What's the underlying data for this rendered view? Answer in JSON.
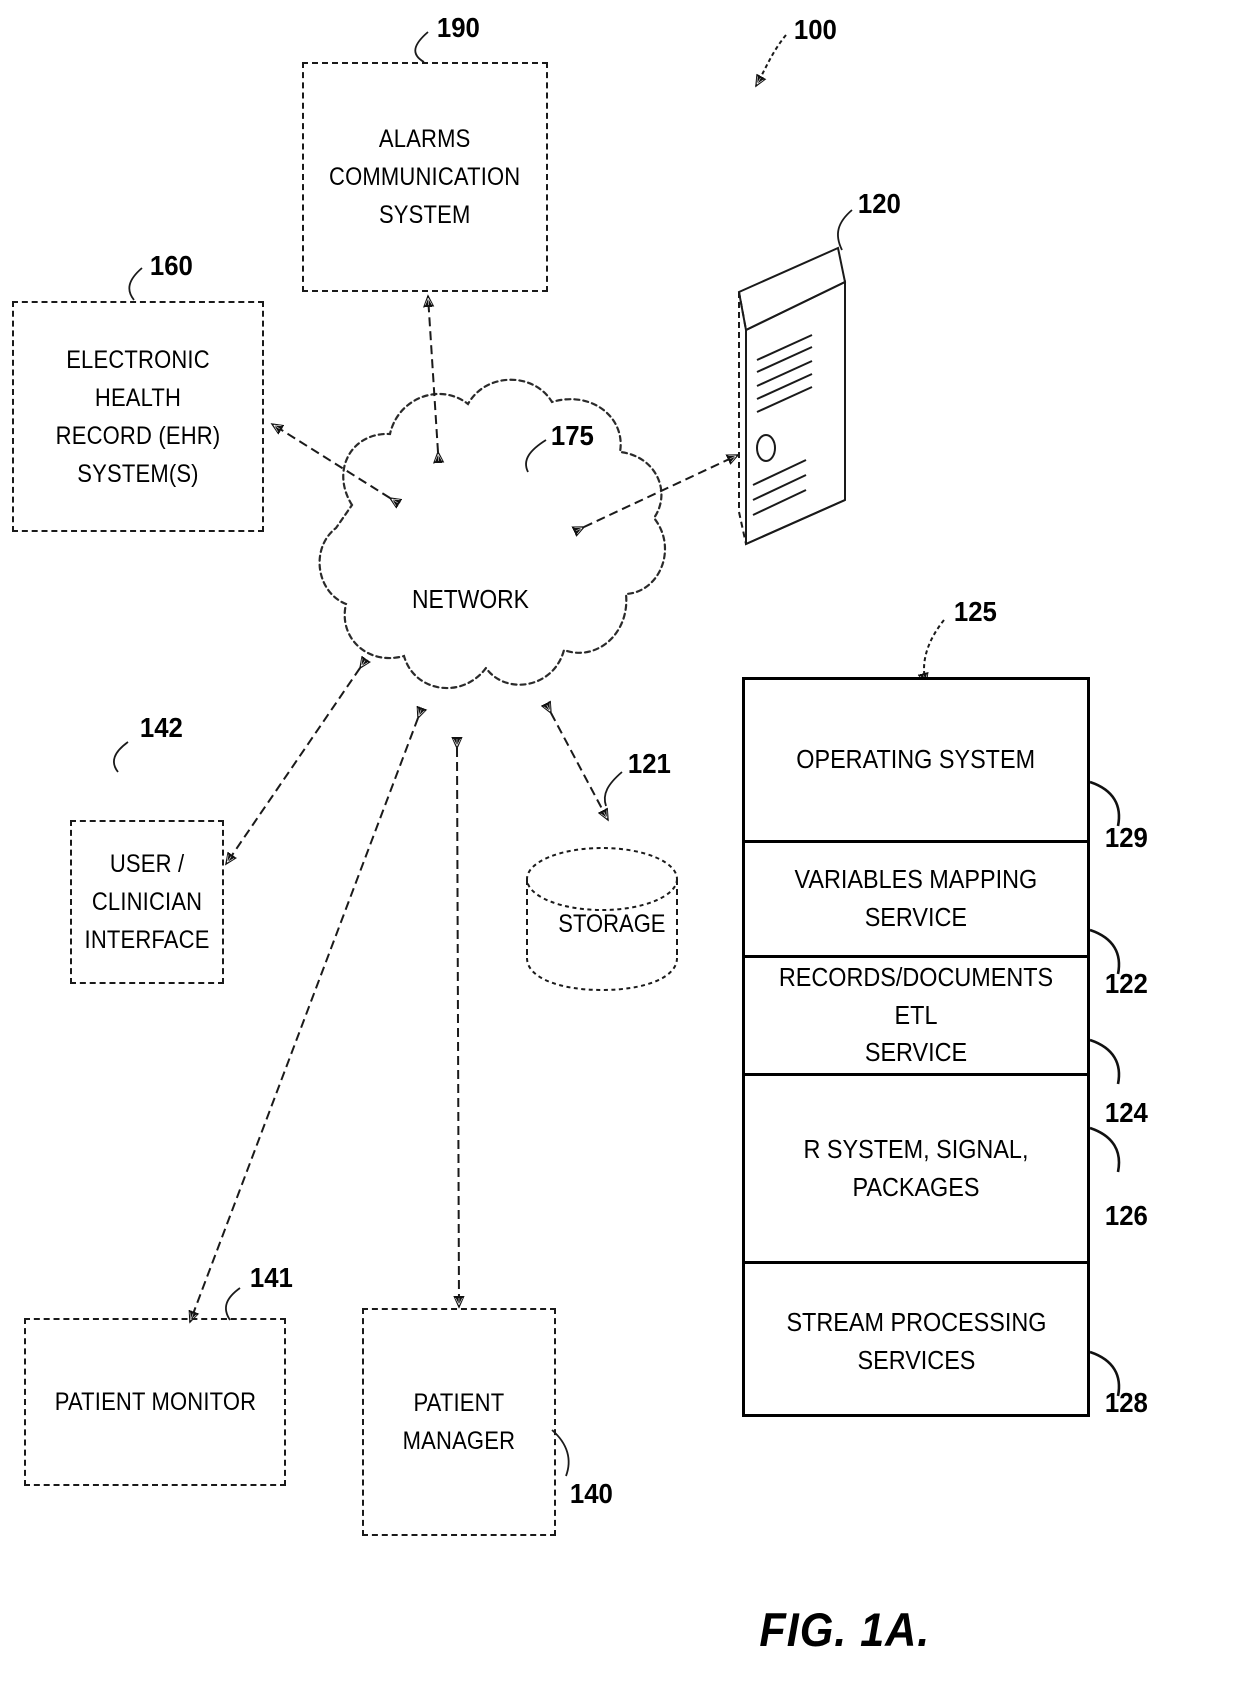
{
  "figure": {
    "caption": "FIG. 1A.",
    "system_ref": "100"
  },
  "nodes": [
    {
      "id": "alarms",
      "name": "alarms-communication-system",
      "label": "ALARMS\nCOMMUNICATION\nSYSTEM",
      "ref": "190"
    },
    {
      "id": "ehr",
      "name": "ehr-system",
      "label": "ELECTRONIC HEALTH\nRECORD (EHR)\nSYSTEM(S)",
      "ref": "160"
    },
    {
      "id": "user-interface",
      "name": "user-clinician-interface",
      "label": "USER /\nCLINICIAN\nINTERFACE",
      "ref": "142"
    },
    {
      "id": "patient-monitor",
      "name": "patient-monitor",
      "label": "PATIENT MONITOR",
      "ref": "141"
    },
    {
      "id": "patient-manager",
      "name": "patient-manager",
      "label": "PATIENT\nMANAGER",
      "ref": "140"
    }
  ],
  "network": {
    "label": "NETWORK",
    "ref": "175"
  },
  "storage": {
    "label": "STORAGE",
    "ref": "121"
  },
  "server": {
    "ref": "120"
  },
  "stack": {
    "ref": "125",
    "rows": [
      {
        "label": "OPERATING SYSTEM",
        "ref": "129"
      },
      {
        "label": "VARIABLES MAPPING\nSERVICE",
        "ref": "122"
      },
      {
        "label": "RECORDS/DOCUMENTS ETL\nSERVICE",
        "ref": "124"
      },
      {
        "label": "R SYSTEM, SIGNAL,\nPACKAGES",
        "ref": "126"
      },
      {
        "label": "STREAM PROCESSING\nSERVICES",
        "ref": "128"
      }
    ]
  },
  "colors": {
    "ink": "#000000",
    "background": "#ffffff"
  }
}
